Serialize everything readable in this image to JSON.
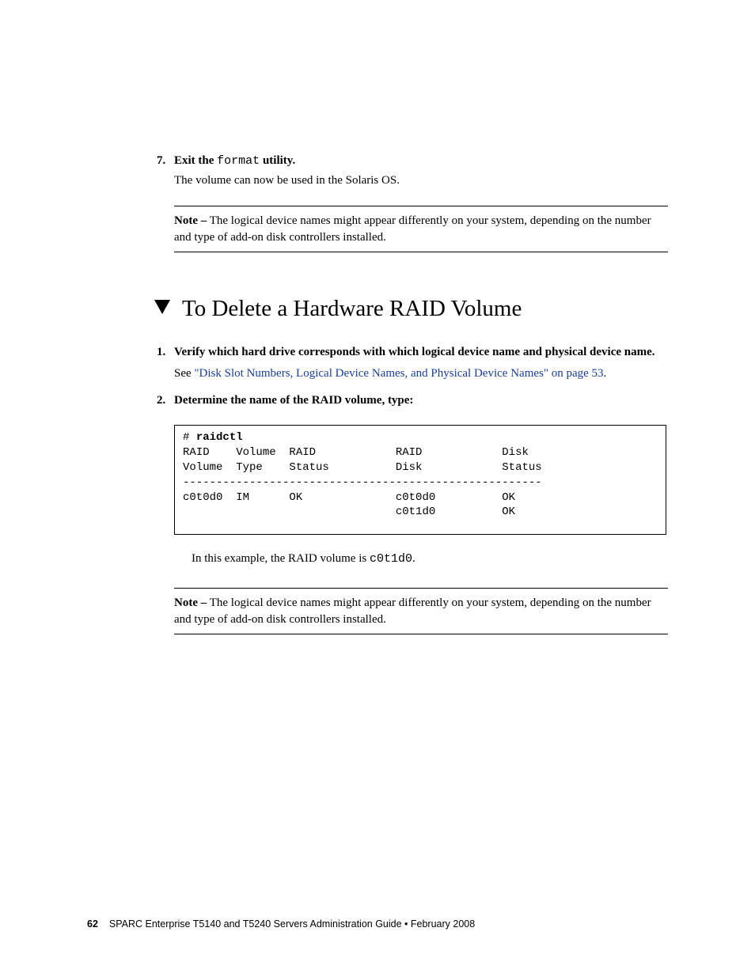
{
  "step7": {
    "num": "7.",
    "prefix": "Exit the ",
    "cmd": "format",
    "suffix": " utility.",
    "followup": "The volume can now be used in the Solaris OS."
  },
  "note1": {
    "label": "Note –",
    "text": " The logical device names might appear differently on your system, depending on the number and type of add-on disk controllers installed."
  },
  "heading": "To Delete a Hardware RAID Volume",
  "step1": {
    "num": "1.",
    "text": "Verify which hard drive corresponds with which logical device name and physical device name.",
    "see_prefix": "See ",
    "link": "\"Disk Slot Numbers, Logical Device Names, and Physical Device Names\" on page 53",
    "see_suffix": "."
  },
  "step2": {
    "num": "2.",
    "text": "Determine the name of the RAID volume, type:"
  },
  "codebox": {
    "prompt": "# ",
    "cmd": "raidctl",
    "body": "RAID    Volume  RAID            RAID            Disk\nVolume  Type    Status          Disk            Status\n------------------------------------------------------\nc0t0d0  IM      OK              c0t0d0          OK\n                                c0t1d0          OK"
  },
  "example": {
    "prefix": "In this example, the RAID volume is ",
    "code": "c0t1d0",
    "suffix": "."
  },
  "note2": {
    "label": "Note –",
    "text": " The logical device names might appear differently on your system, depending on the number and type of add-on disk controllers installed."
  },
  "footer": {
    "page": "62",
    "text": "SPARC Enterprise T5140 and T5240 Servers Administration Guide • February 2008"
  }
}
